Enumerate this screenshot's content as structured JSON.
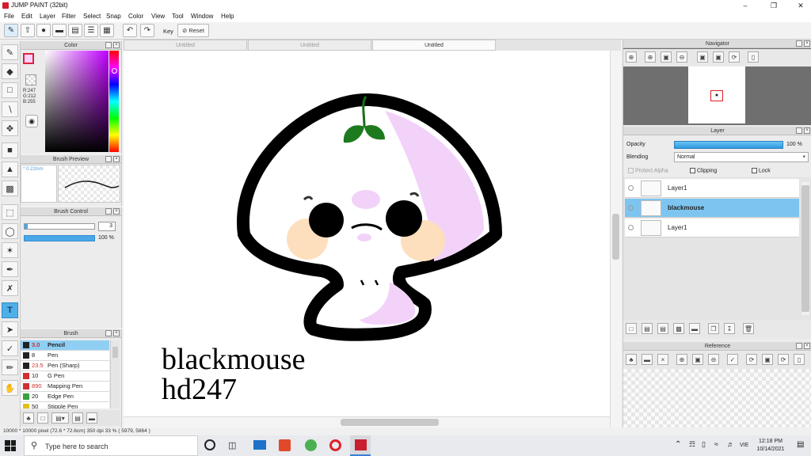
{
  "window": {
    "title": "JUMP PAINT (32bit)"
  },
  "menu": [
    "File",
    "Edit",
    "Layer",
    "Filter",
    "Select",
    "Snap",
    "Color",
    "View",
    "Tool",
    "Window",
    "Help"
  ],
  "toolbar": {
    "key_label": "Key",
    "reset_label": "Reset"
  },
  "tabs": [
    "Untitled",
    "Untitled",
    "Untitled"
  ],
  "color_panel": {
    "title": "Color",
    "r": "R:247",
    "g": "G:212",
    "b": "B:255",
    "accent": "#f7d4ff"
  },
  "brush_preview": {
    "title": "Brush Preview",
    "size": "* 0.22mm"
  },
  "brush_control": {
    "title": "Brush Control",
    "size_value": "3",
    "opacity_value": "100 %"
  },
  "brush_panel": {
    "title": "Brush",
    "items": [
      {
        "size": "3.0",
        "name": "Pencil",
        "color": "#222222",
        "selected": true,
        "size_color": "#d23030"
      },
      {
        "size": "8",
        "name": "Pen",
        "color": "#222222",
        "size_color": "#222"
      },
      {
        "size": "23.5",
        "name": "Pen (Sharp)",
        "color": "#222222",
        "size_color": "#d23030"
      },
      {
        "size": "10",
        "name": "G Pen",
        "color": "#d03030",
        "size_color": "#222"
      },
      {
        "size": "890",
        "name": "Mapping Pen",
        "color": "#d03030",
        "size_color": "#d23030"
      },
      {
        "size": "20",
        "name": "Edge Pen",
        "color": "#3aa040",
        "size_color": "#222"
      },
      {
        "size": "50",
        "name": "Stipple Pen",
        "color": "#e0c020",
        "size_color": "#222"
      }
    ]
  },
  "navigator": {
    "title": "Navigator"
  },
  "layer_panel": {
    "title": "Layer",
    "opacity_label": "Opacity",
    "opacity_value": "100 %",
    "blending_label": "Blending",
    "blending_value": "Normal",
    "protect_alpha": "Protect Alpha",
    "clipping": "Clipping",
    "lock": "Lock",
    "layers": [
      {
        "name": "Layer1",
        "selected": false
      },
      {
        "name": "blackmouse",
        "selected": true
      },
      {
        "name": "Layer1",
        "selected": false
      }
    ]
  },
  "reference": {
    "title": "Reference"
  },
  "canvas": {
    "text_line1": "blackmouse",
    "text_line2": "hd247"
  },
  "status": {
    "text": "10000 * 10000 pixel  (72.6 * 72.6cm)  350 dpi  33 %  ( 5979, 5864 )"
  },
  "taskbar": {
    "search_placeholder": "Type here to search",
    "time": "12:18 PM",
    "date": "10/14/2021",
    "lang": "VIE"
  }
}
